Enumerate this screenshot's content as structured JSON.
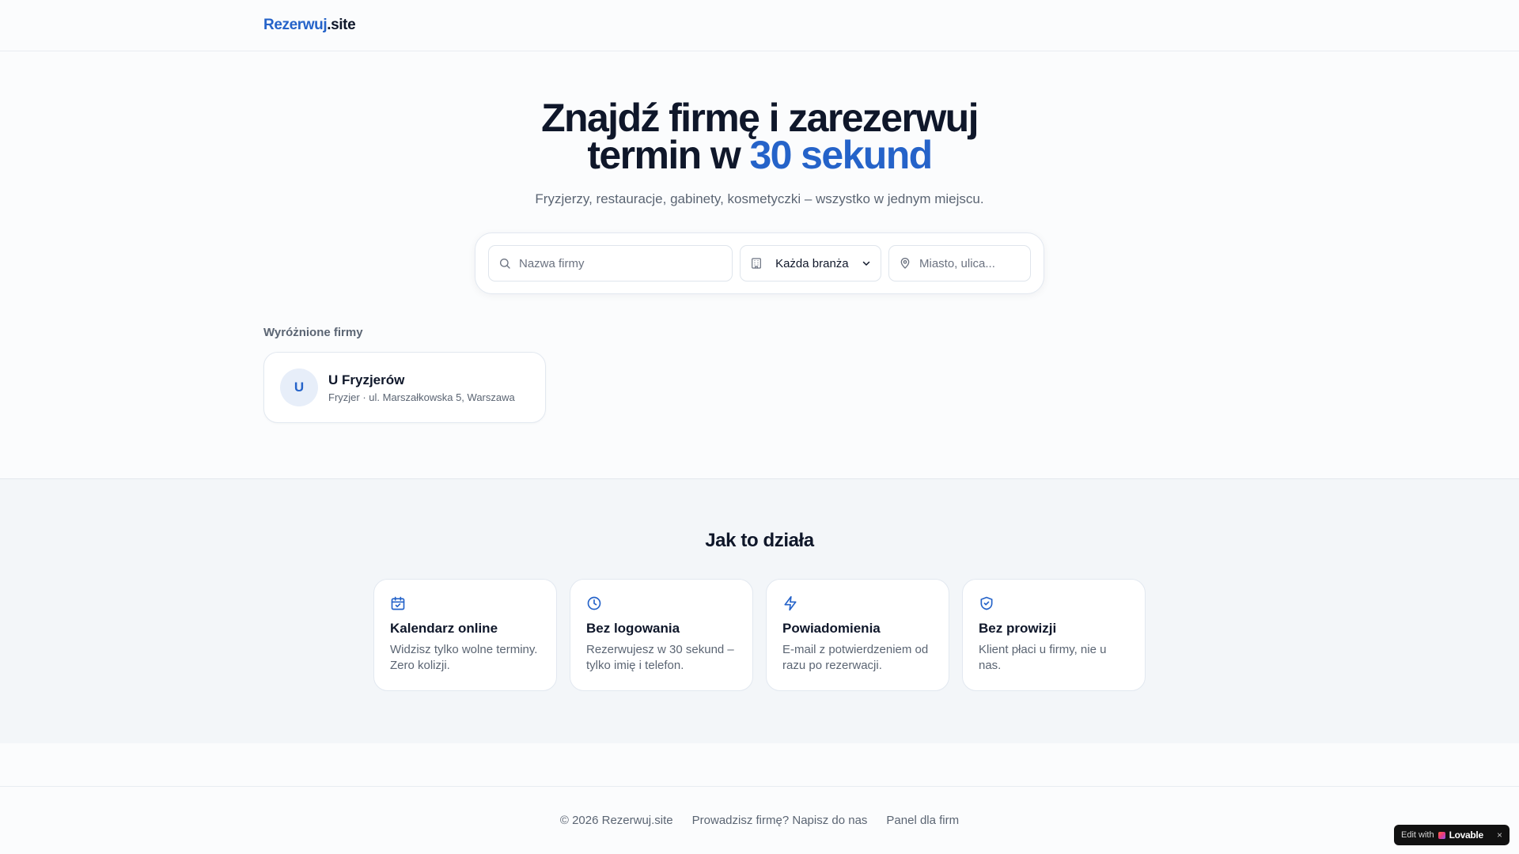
{
  "header": {
    "logo_accent": "Rezerwuj",
    "logo_rest": ".site"
  },
  "hero": {
    "title_line1": "Znajdź firmę i zarezerwuj",
    "title_line2_prefix": "termin w ",
    "title_line2_accent": "30 sekund",
    "subtitle": "Fryzjerzy, restauracje, gabinety, kosmetyczki – wszystko w jednym miejscu."
  },
  "search": {
    "name_placeholder": "Nazwa firmy",
    "branch_selected": "Każda branża",
    "city_placeholder": "Miasto, ulica..."
  },
  "featured": {
    "title": "Wyróżnione firmy",
    "businesses": [
      {
        "initial": "U",
        "name": "U Fryzjerów",
        "meta": "Fryzjer · ul. Marszałkowska 5, Warszawa"
      }
    ]
  },
  "how": {
    "title": "Jak to działa",
    "cards": [
      {
        "icon": "calendar-check-icon",
        "title": "Kalendarz online",
        "text": "Widzisz tylko wolne terminy. Zero kolizji."
      },
      {
        "icon": "clock-icon",
        "title": "Bez logowania",
        "text": "Rezerwujesz w 30 sekund – tylko imię i telefon."
      },
      {
        "icon": "lightning-icon",
        "title": "Powiadomienia",
        "text": "E-mail z potwierdzeniem od razu po rezerwacji."
      },
      {
        "icon": "shield-check-icon",
        "title": "Bez prowizji",
        "text": "Klient płaci u firmy, nie u nas."
      }
    ]
  },
  "footer": {
    "copyright": "© 2026 Rezerwuj.site",
    "contact_link": "Prowadzisz firmę? Napisz do nas",
    "panel_link": "Panel dla firm"
  },
  "badge": {
    "prefix": "Edit with",
    "brand": "Lovable",
    "close": "×"
  },
  "colors": {
    "accent": "#2563c9",
    "text": "#0f172a",
    "muted": "#5b6573",
    "section_bg": "#f3f6f9"
  }
}
